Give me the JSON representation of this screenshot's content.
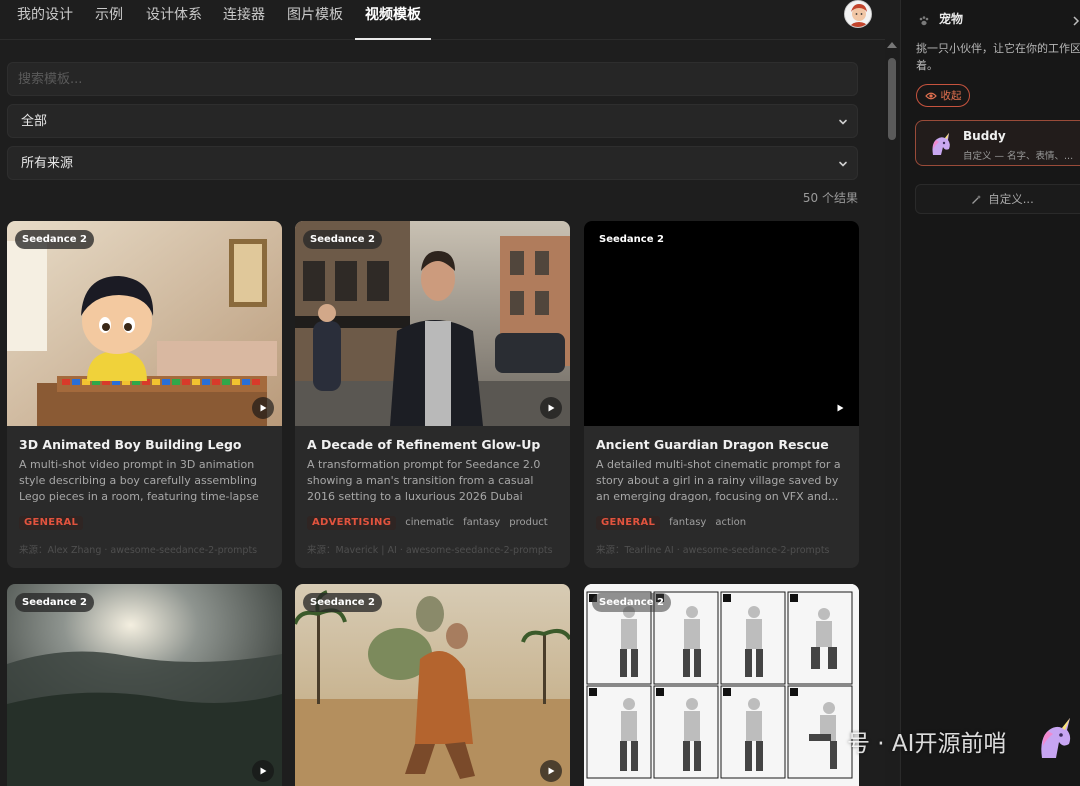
{
  "nav": {
    "tabs": [
      {
        "label": "我的设计",
        "active": false
      },
      {
        "label": "示例",
        "active": false
      },
      {
        "label": "设计体系",
        "active": false
      },
      {
        "label": "连接器",
        "active": false
      },
      {
        "label": "图片模板",
        "active": false
      },
      {
        "label": "视频模板",
        "active": true
      }
    ]
  },
  "filters": {
    "search_placeholder": "搜索模板...",
    "category_value": "全部",
    "source_value": "所有来源",
    "results_text": "50 个结果"
  },
  "cards": [
    {
      "badge": "Seedance 2",
      "title": "3D Animated Boy Building Lego",
      "description": "A multi-shot video prompt in 3D animation style describing a boy carefully assembling Lego pieces in a room, featuring time-lapse effects.",
      "category": "GENERAL",
      "tags": [],
      "source": "来源：Alex Zhang · awesome-seedance-2-prompts"
    },
    {
      "badge": "Seedance 2",
      "title": "A Decade of Refinement Glow-Up",
      "description": "A transformation prompt for Seedance 2.0 showing a man's transition from a casual 2016 setting to a luxurious 2026 Dubai lifestyle whil...",
      "category": "ADVERTISING",
      "tags": [
        "cinematic",
        "fantasy",
        "product"
      ],
      "source": "来源：Maverick | AI · awesome-seedance-2-prompts"
    },
    {
      "badge": "Seedance 2",
      "title": "Ancient Guardian Dragon Rescue",
      "description": "A detailed multi-shot cinematic prompt for a story about a girl in a rainy village saved by an emerging dragon, focusing on VFX and...",
      "category": "GENERAL",
      "tags": [
        "fantasy",
        "action"
      ],
      "source": "来源：Tearline AI · awesome-seedance-2-prompts"
    },
    {
      "badge": "Seedance 2"
    },
    {
      "badge": "Seedance 2"
    },
    {
      "badge": "Seedance 2"
    }
  ],
  "panel": {
    "title": "宠物",
    "description": "挑一只小伙伴，让它在你的工作区着。",
    "collect_label": "收起",
    "buddy_name": "Buddy",
    "buddy_sub": "自定义 — 名字、表情、...",
    "custom_label": "自定义..."
  },
  "watermark": "号 · AI开源前哨",
  "colors": {
    "background": "#1e1e1e",
    "card": "#2a2a2a",
    "accent": "#e2533e"
  }
}
